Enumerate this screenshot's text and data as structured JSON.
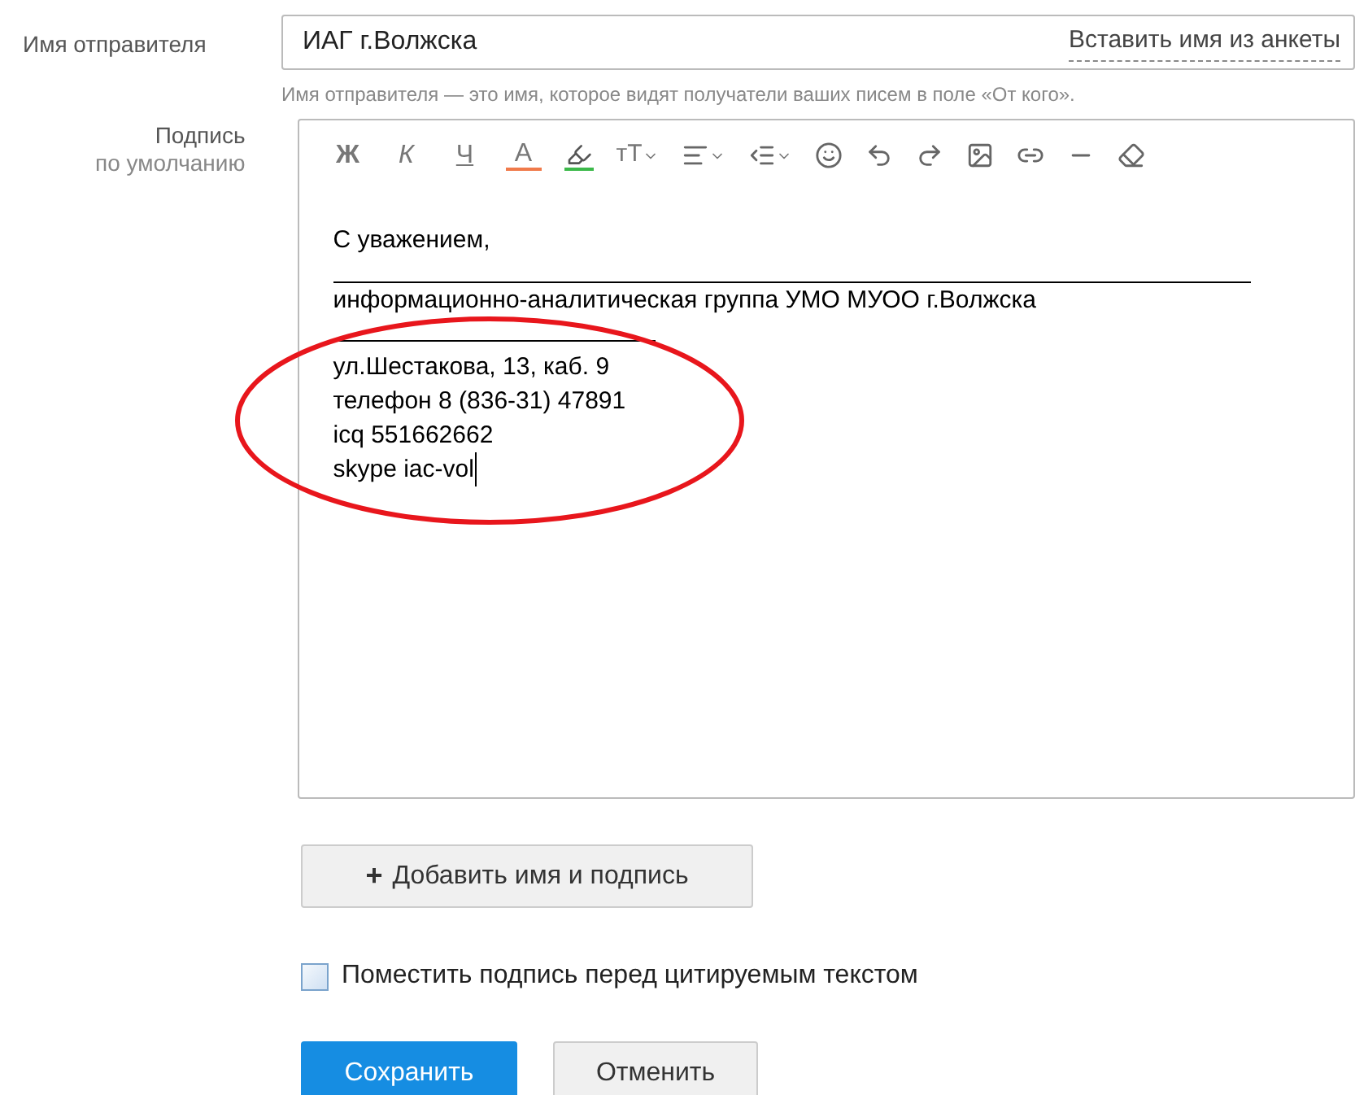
{
  "sender": {
    "label": "Имя отправителя",
    "value": "ИАГ г.Волжска",
    "insert_link": "Вставить имя из анкеты",
    "hint": "Имя отправителя — это имя, которое видят получатели ваших писем в поле «От кого»."
  },
  "signature": {
    "label_line_1": "Подпись",
    "label_line_2": "по умолчанию",
    "toolbar": [
      {
        "kind": "letter",
        "text": "Ж",
        "italic": false
      },
      {
        "kind": "letter",
        "text": "К",
        "italic": true
      },
      {
        "kind": "underline-letter",
        "text": "Ч"
      },
      {
        "kind": "color-letter",
        "text": "A"
      },
      {
        "kind": "highlighter"
      },
      {
        "kind": "font-size",
        "text": "тТ"
      },
      {
        "kind": "align"
      },
      {
        "kind": "indent"
      },
      {
        "kind": "smile"
      },
      {
        "kind": "undo"
      },
      {
        "kind": "redo"
      },
      {
        "kind": "image"
      },
      {
        "kind": "link"
      },
      {
        "kind": "hr"
      },
      {
        "kind": "eraser"
      }
    ],
    "lines": [
      {
        "kind": "text",
        "text": "С уважением,",
        "caret": false
      },
      {
        "kind": "long-rule"
      },
      {
        "kind": "text",
        "text": "информационно-аналитическая группа УМО МУОО г.Волжска",
        "caret": false
      },
      {
        "kind": "short-rule"
      },
      {
        "kind": "text",
        "text": "ул.Шестакова, 13, каб. 9",
        "caret": false
      },
      {
        "kind": "text",
        "text": "телефон 8 (836-31) 47891",
        "caret": false
      },
      {
        "kind": "text",
        "text": "icq 551662662",
        "caret": false
      },
      {
        "kind": "text",
        "text": "skype iac-vol",
        "caret": true
      }
    ]
  },
  "add_button": {
    "icon": "+",
    "label": "Добавить имя и подпись"
  },
  "place_before_quote": {
    "label": "Поместить подпись перед цитируемым текстом",
    "checked": false
  },
  "buttons": [
    {
      "label": "Сохранить",
      "primary": true
    },
    {
      "label": "Отменить",
      "primary": false
    }
  ]
}
